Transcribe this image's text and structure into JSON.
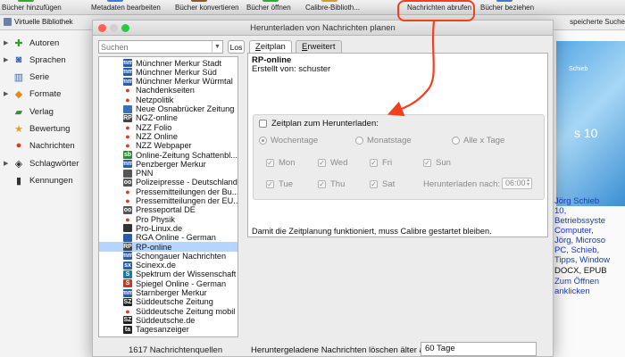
{
  "toolbar": {
    "items": [
      {
        "label": "Bücher hinzufügen",
        "icon": "add-book-icon",
        "color": "#3aa33a"
      },
      {
        "label": "Metadaten bearbeiten",
        "icon": "edit-metadata-icon",
        "color": "#4a78c8"
      },
      {
        "label": "Bücher konvertieren",
        "icon": "convert-icon",
        "color": "#8a5a2a"
      },
      {
        "label": "Bücher öffnen",
        "icon": "open-book-icon",
        "color": "#3aa33a"
      },
      {
        "label": "Calibre-Biblioth...",
        "icon": "library-icon",
        "color": "#c8a040"
      },
      {
        "label": "Nachrichten abrufen",
        "icon": "news-icon",
        "color": "#d03020"
      },
      {
        "label": "Bücher beziehen",
        "icon": "get-books-icon",
        "color": "#4a78c8"
      }
    ]
  },
  "subbar": {
    "virtual_library": "Virtuelle Bibliothek",
    "saved_search": "speicherte Suche"
  },
  "sidebar": {
    "items": [
      {
        "label": "Autoren",
        "icon": "authors-icon",
        "expandable": true
      },
      {
        "label": "Sprachen",
        "icon": "languages-icon",
        "expandable": true
      },
      {
        "label": "Serie",
        "icon": "series-icon",
        "expandable": false
      },
      {
        "label": "Formate",
        "icon": "formats-icon",
        "expandable": true
      },
      {
        "label": "Verlag",
        "icon": "publisher-icon",
        "expandable": false
      },
      {
        "label": "Bewertung",
        "icon": "rating-icon",
        "expandable": false
      },
      {
        "label": "Nachrichten",
        "icon": "news-icon",
        "expandable": false
      },
      {
        "label": "Schlagwörter",
        "icon": "tags-icon",
        "expandable": true
      },
      {
        "label": "Kennungen",
        "icon": "identifiers-icon",
        "expandable": false
      }
    ]
  },
  "right_pane": {
    "cover_top_text": "Schieb",
    "cover_text": "s 10",
    "author_line": "Jörg Schieb",
    "lines": [
      "10,",
      "Betriebssyste",
      "Computer,",
      "Jörg, Microso",
      "PC, Schieb,",
      "Tipps, Window"
    ],
    "formats": "DOCX, EPUB",
    "open_link": [
      "Zum Öffnen",
      "anklicken"
    ]
  },
  "dialog": {
    "title": "Herunterladen von Nachrichten planen",
    "search": {
      "placeholder": "Suchen",
      "value": ""
    },
    "search_button": "Los",
    "sources": [
      {
        "label": "Münchner Merkur Stadt",
        "icon": "mm",
        "color": "#2a5ca8"
      },
      {
        "label": "Münchner Merkur Süd",
        "icon": "mm",
        "color": "#2a5ca8"
      },
      {
        "label": "Münchner Merkur Würmtal",
        "icon": "mm",
        "color": "#2a5ca8"
      },
      {
        "label": "Nachdenkseiten",
        "icon": "pin",
        "color": "#e03a1e"
      },
      {
        "label": "Netzpolitik",
        "icon": "pin",
        "color": "#e03a1e"
      },
      {
        "label": "Neue Osnabrücker Zeitung",
        "icon": "noz",
        "color": "#3a6fbf"
      },
      {
        "label": "NGZ-online",
        "icon": "RP",
        "color": "#444444"
      },
      {
        "label": "NZZ Folio",
        "icon": "pin",
        "color": "#e03a1e"
      },
      {
        "label": "NZZ Online",
        "icon": "pin",
        "color": "#e03a1e"
      },
      {
        "label": "NZZ Webpaper",
        "icon": "pin",
        "color": "#e03a1e"
      },
      {
        "label": "Online-Zeitung Schattenbl...",
        "icon": "sb",
        "color": "#2e8b2e"
      },
      {
        "label": "Penzberger Merkur",
        "icon": "mm",
        "color": "#2a5ca8"
      },
      {
        "label": "PNN",
        "icon": "pnn",
        "color": "#555555"
      },
      {
        "label": "Polizeipresse - Deutschland",
        "icon": "oo",
        "color": "#555555"
      },
      {
        "label": "Pressemitteilungen der Bu...",
        "icon": "pin",
        "color": "#e03a1e"
      },
      {
        "label": "Pressemitteilungen der EU...",
        "icon": "pin",
        "color": "#e03a1e"
      },
      {
        "label": "Presseportal DE",
        "icon": "oo",
        "color": "#555555"
      },
      {
        "label": "Pro Physik",
        "icon": "pin",
        "color": "#e03a1e"
      },
      {
        "label": "Pro-Linux.de",
        "icon": "tux",
        "color": "#333333"
      },
      {
        "label": "RGA Online - German",
        "icon": "rga",
        "color": "#2a5ca8"
      },
      {
        "label": "RP-online",
        "icon": "RP",
        "color": "#444444",
        "selected": true
      },
      {
        "label": "Schongauer Nachrichten",
        "icon": "mm",
        "color": "#2a5ca8"
      },
      {
        "label": "Scinexx.de",
        "icon": "sx",
        "color": "#2a5ca8"
      },
      {
        "label": "Spektrum der Wissenschaft",
        "icon": "S",
        "color": "#1a7a9a"
      },
      {
        "label": "Spiegel Online - German",
        "icon": "S",
        "color": "#c0392b"
      },
      {
        "label": "Starnberger Merkur",
        "icon": "mm",
        "color": "#2a5ca8"
      },
      {
        "label": "Süddeutsche Zeitung",
        "icon": "SZ",
        "color": "#222222"
      },
      {
        "label": "Süddeutsche Zeitung mobil",
        "icon": "pin",
        "color": "#e03a1e"
      },
      {
        "label": "Süddeutsche.de",
        "icon": "SZ",
        "color": "#222222"
      },
      {
        "label": "Tagesanzeiger",
        "icon": "ta",
        "color": "#222222"
      }
    ],
    "source_count": "1617 Nachrichtenquellen",
    "tabs": [
      {
        "label": "Zeitplan",
        "mnemonic": "Z",
        "active": true
      },
      {
        "label": "Erweitert",
        "mnemonic": "E",
        "active": false
      }
    ],
    "feed_title": "RP-online",
    "feed_author": "Erstellt von: schuster",
    "schedule": {
      "enable_label": "Zeitplan zum Herunterladen:",
      "enabled": false,
      "modes": [
        {
          "label": "Wochentage",
          "selected": true
        },
        {
          "label": "Monatstage",
          "selected": false
        },
        {
          "label": "Alle x Tage",
          "selected": false
        }
      ],
      "days": [
        {
          "label": "Mon",
          "checked": true
        },
        {
          "label": "Wed",
          "checked": true
        },
        {
          "label": "Fri",
          "checked": true
        },
        {
          "label": "Sun",
          "checked": true
        },
        {
          "label": "Tue",
          "checked": true
        },
        {
          "label": "Thu",
          "checked": true
        },
        {
          "label": "Sat",
          "checked": true
        }
      ],
      "time_label": "Herunterladen nach:",
      "time_value": "06:00"
    },
    "note": "Damit die Zeitplanung funktioniert, muss Calibre gestartet bleiben.",
    "delete_label": "Heruntergeladene Nachrichten löschen älter als:",
    "delete_value": "60 Tage"
  },
  "colors": {
    "callout": "#f0401d",
    "selection": "#b5d5ff",
    "link": "#1a39c9"
  }
}
